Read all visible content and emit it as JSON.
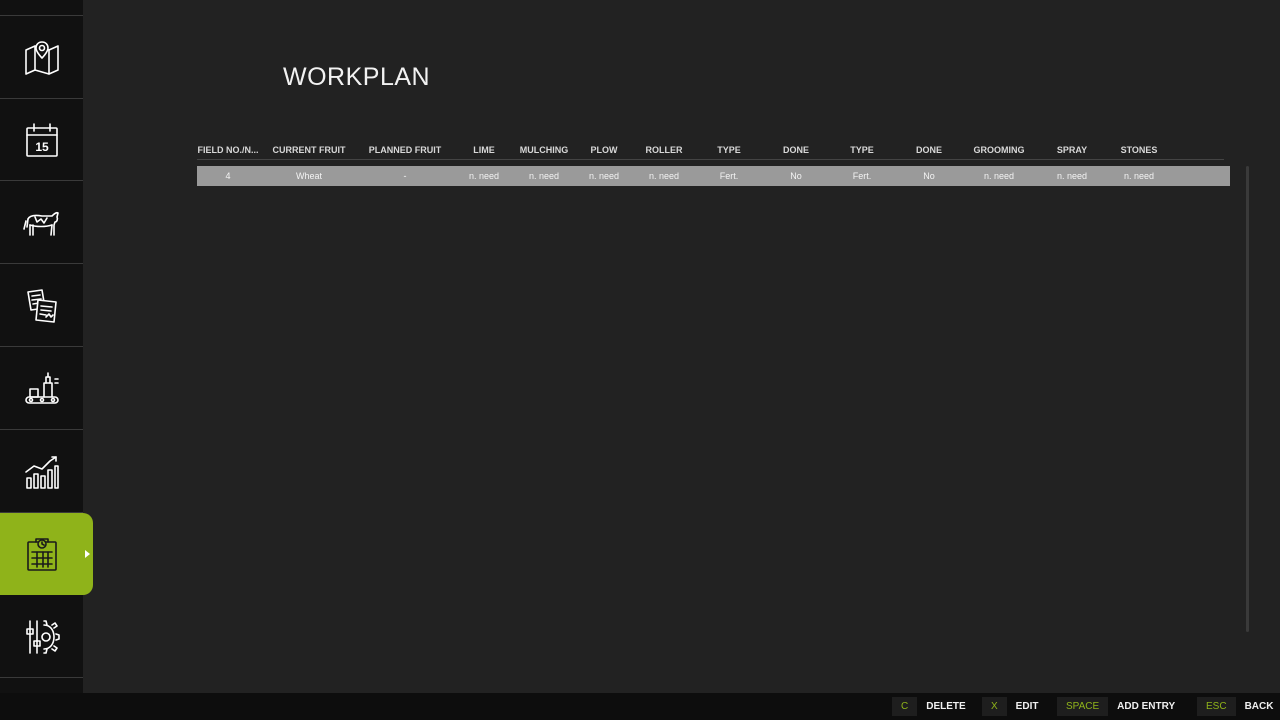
{
  "page": {
    "title": "WORKPLAN"
  },
  "sidebar": {
    "items": [
      {
        "icon": "map-icon"
      },
      {
        "icon": "calendar-icon",
        "text": "15"
      },
      {
        "icon": "cow-icon"
      },
      {
        "icon": "contracts-icon"
      },
      {
        "icon": "production-icon"
      },
      {
        "icon": "statistics-icon"
      },
      {
        "icon": "workplan-icon",
        "active": true
      },
      {
        "icon": "settings-icon"
      }
    ]
  },
  "table": {
    "headers": [
      "FIELD NO./N...",
      "CURRENT FRUIT",
      "PLANNED FRUIT",
      "LIME",
      "MULCHING",
      "PLOW",
      "ROLLER",
      "TYPE",
      "DONE",
      "TYPE",
      "DONE",
      "GROOMING",
      "SPRAY",
      "STONES"
    ],
    "rows": [
      [
        "4",
        "Wheat",
        "-",
        "n. need",
        "n. need",
        "n. need",
        "n. need",
        "Fert.",
        "No",
        "Fert.",
        "No",
        "n. need",
        "n. need",
        "n. need"
      ]
    ]
  },
  "bottombar": {
    "hints": [
      {
        "key": "C",
        "label": "DELETE"
      },
      {
        "key": "X",
        "label": "EDIT"
      },
      {
        "key": "SPACE",
        "label": "ADD ENTRY"
      },
      {
        "key": "ESC",
        "label": "BACK"
      }
    ]
  },
  "colors": {
    "accent": "#8fb31a",
    "background": "#222222",
    "sidebar": "#111111",
    "selected_row": "#9a9a9a"
  }
}
